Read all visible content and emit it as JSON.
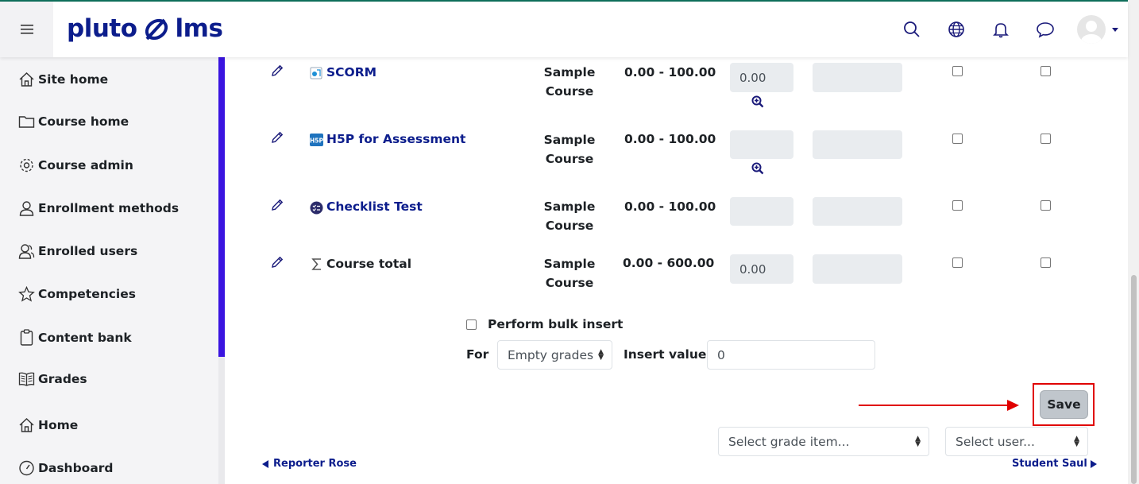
{
  "brand": {
    "name_left": "pluto",
    "name_right": "lms"
  },
  "navbar": {
    "icons": [
      "search-icon",
      "globe-icon",
      "bell-icon",
      "chat-icon"
    ]
  },
  "sidebar": {
    "items": [
      {
        "label": "Site home",
        "icon": "home-icon"
      },
      {
        "label": "Course home",
        "icon": "folder-icon"
      },
      {
        "label": "Course admin",
        "icon": "gear-icon"
      },
      {
        "label": "Enrollment methods",
        "icon": "user-icon"
      },
      {
        "label": "Enrolled users",
        "icon": "users-icon"
      },
      {
        "label": "Competencies",
        "icon": "star-icon"
      },
      {
        "label": "Content bank",
        "icon": "clipboard-icon"
      },
      {
        "label": "Grades",
        "icon": "book-icon"
      },
      {
        "label": "Home",
        "icon": "home-icon"
      },
      {
        "label": "Dashboard",
        "icon": "gauge-icon"
      }
    ]
  },
  "grades": {
    "rows": [
      {
        "name": "SCORM",
        "icon": "scorm-icon",
        "course_line1": "Sample",
        "course_line2": "Course",
        "range": "0.00 - 100.00",
        "grade": "0.00",
        "feedback": "",
        "has_zoom": true,
        "is_link": true
      },
      {
        "name": "H5P for Assessment",
        "icon": "h5p-icon",
        "course_line1": "Sample",
        "course_line2": "Course",
        "range": "0.00 - 100.00",
        "grade": "",
        "feedback": "",
        "has_zoom": true,
        "is_link": true
      },
      {
        "name": "Checklist Test",
        "icon": "checklist-icon",
        "course_line1": "Sample",
        "course_line2": "Course",
        "range": "0.00 - 100.00",
        "grade": "",
        "feedback": "",
        "has_zoom": false,
        "is_link": true
      },
      {
        "name": "Course total",
        "icon": "sigma-icon",
        "course_line1": "Sample",
        "course_line2": "Course",
        "range": "0.00 - 600.00",
        "grade": "0.00",
        "feedback": "",
        "has_zoom": false,
        "is_link": false
      }
    ]
  },
  "bulk": {
    "checkbox_label": "Perform bulk insert",
    "for_label": "For",
    "for_select": "Empty grades",
    "insert_label": "Insert value",
    "insert_value": "0"
  },
  "actions": {
    "save_label": "Save"
  },
  "footer": {
    "select_item": "Select grade item...",
    "select_user": "Select user...",
    "prev_user": "Reporter Rose",
    "next_user": "Student Saul"
  },
  "colors": {
    "brand": "#0c1d8c",
    "accent": "#3a14e0",
    "highlight": "#e00000"
  }
}
